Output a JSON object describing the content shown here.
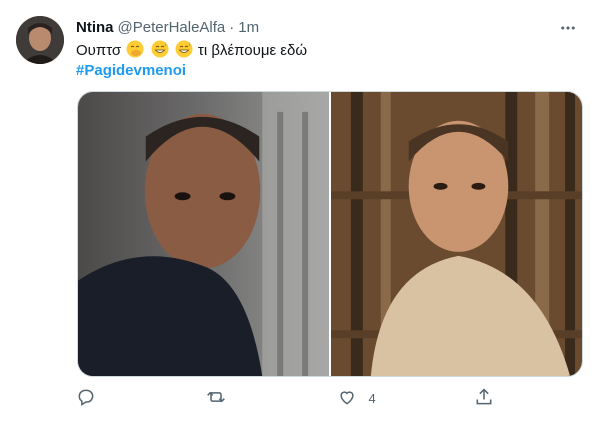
{
  "tweet": {
    "author_name": "Ntina",
    "handle": "@PeterHaleAlfa",
    "separator": "·",
    "time": "1m",
    "text_part1": "Ουπτσ",
    "text_part2": "τι βλέπουμε εδώ",
    "emojis": [
      "face-with-hand-over-mouth",
      "grinning-sweat",
      "grinning-sweat"
    ],
    "hashtag": "#Pagidevmenoi",
    "media": [
      {
        "subject": "man-dark-hoodie-prison-corridor"
      },
      {
        "subject": "man-beige-tshirt-prison-bars"
      }
    ],
    "actions": {
      "reply_count": "",
      "retweet_count": "",
      "like_count": "4",
      "share_count": ""
    },
    "colors": {
      "accent": "#1d9bf0",
      "muted": "#536471"
    }
  }
}
